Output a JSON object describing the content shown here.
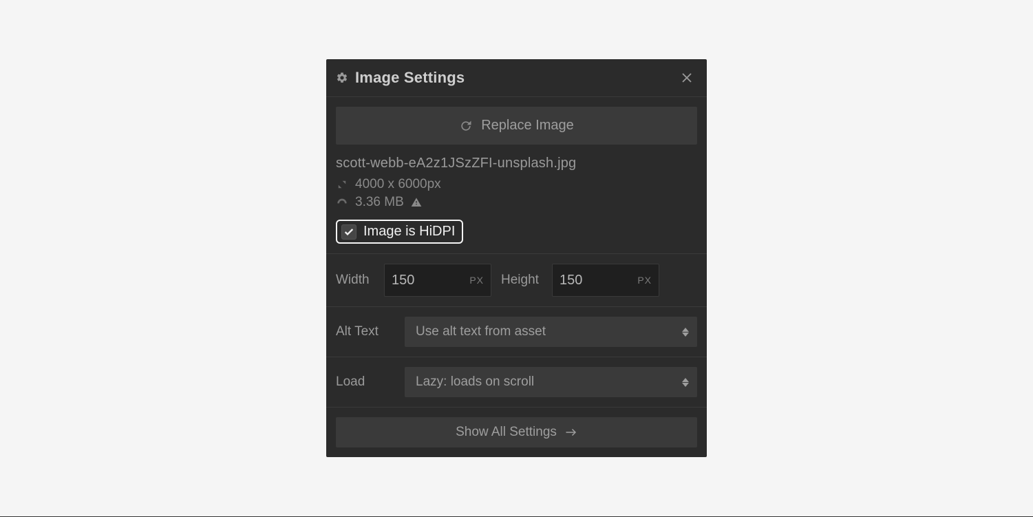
{
  "header": {
    "title": "Image Settings"
  },
  "replace": {
    "label": "Replace Image"
  },
  "file": {
    "name": "scott-webb-eA2z1JSzZFI-unsplash.jpg",
    "dimensions": "4000 x 6000px",
    "size": "3.36 MB"
  },
  "hidpi": {
    "label": "Image is HiDPI",
    "checked": true
  },
  "dims": {
    "width_label": "Width",
    "width_value": "150",
    "width_unit": "PX",
    "height_label": "Height",
    "height_value": "150",
    "height_unit": "PX"
  },
  "alt": {
    "label": "Alt Text",
    "value": "Use alt text from asset"
  },
  "load": {
    "label": "Load",
    "value": "Lazy: loads on scroll"
  },
  "footer": {
    "show_all": "Show All Settings"
  }
}
